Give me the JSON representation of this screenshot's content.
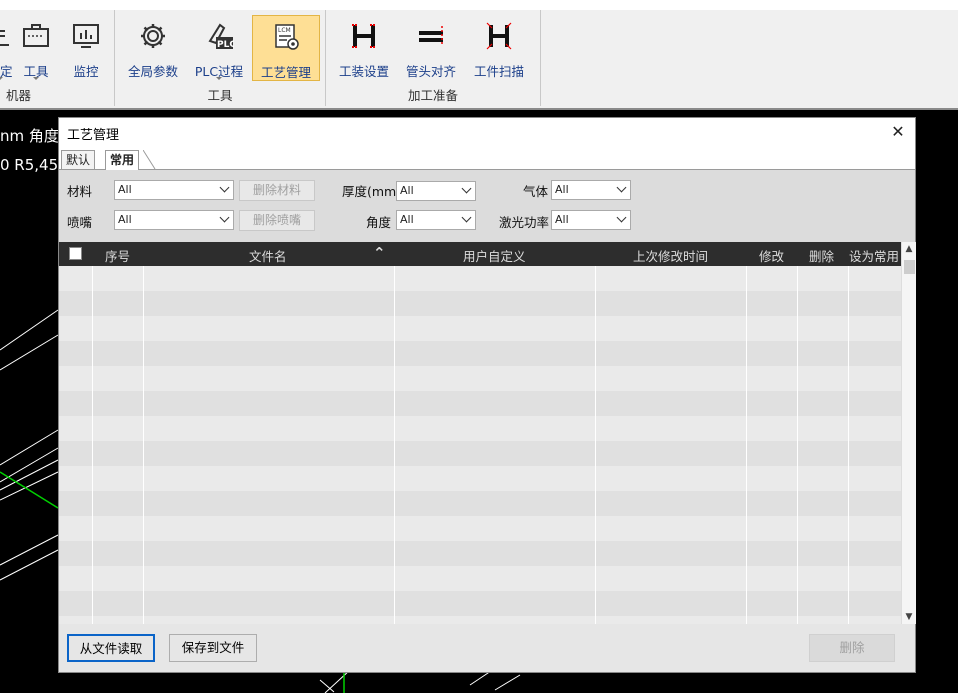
{
  "ribbon": {
    "groups": [
      {
        "title": "机器",
        "buttons": [
          {
            "label": "标定",
            "icon": "calibrate-icon"
          },
          {
            "label": "工具",
            "icon": "toolbox-icon"
          },
          {
            "label": "监控",
            "icon": "monitor-icon"
          }
        ]
      },
      {
        "title": "工具",
        "buttons": [
          {
            "label": "全局参数",
            "icon": "gear-icon"
          },
          {
            "label": "PLC过程",
            "icon": "plc-icon"
          },
          {
            "label": "工艺管理",
            "icon": "lcm-settings-icon",
            "active": true
          }
        ]
      },
      {
        "title": "加工准备",
        "buttons": [
          {
            "label": "工装设置",
            "icon": "fixture-icon"
          },
          {
            "label": "管头对齐",
            "icon": "tube-align-icon"
          },
          {
            "label": "工件扫描",
            "icon": "workpiece-scan-icon"
          }
        ]
      }
    ]
  },
  "background": {
    "line1": "nm 角度",
    "line2": "0  R5,45"
  },
  "dialog": {
    "title": "工艺管理",
    "close_symbol": "✕",
    "tabs": [
      {
        "label": "默认",
        "selected": false
      },
      {
        "label": "常用",
        "selected": true
      }
    ],
    "filters": {
      "material_label": "材料",
      "material_value": "All",
      "delete_material": "删除材料",
      "nozzle_label": "喷嘴",
      "nozzle_value": "All",
      "delete_nozzle": "删除喷嘴",
      "thickness_label": "厚度(mm)",
      "thickness_value": "All",
      "angle_label": "角度",
      "angle_value": "All",
      "gas_label": "气体",
      "gas_value": "All",
      "power_label": "激光功率",
      "power_value": "All"
    },
    "table": {
      "columns": [
        "序号",
        "文件名",
        "用户自定义",
        "上次修改时间",
        "修改",
        "删除",
        "设为常用"
      ],
      "sort_symbol": "⌃",
      "rows": []
    },
    "footer": {
      "load_button": "从文件读取",
      "save_button": "保存到文件",
      "delete_button": "删除"
    }
  },
  "colors": {
    "accent_active": "#fedf95",
    "header_bg": "#2d2d2d",
    "primary_border": "#0a64c8"
  }
}
